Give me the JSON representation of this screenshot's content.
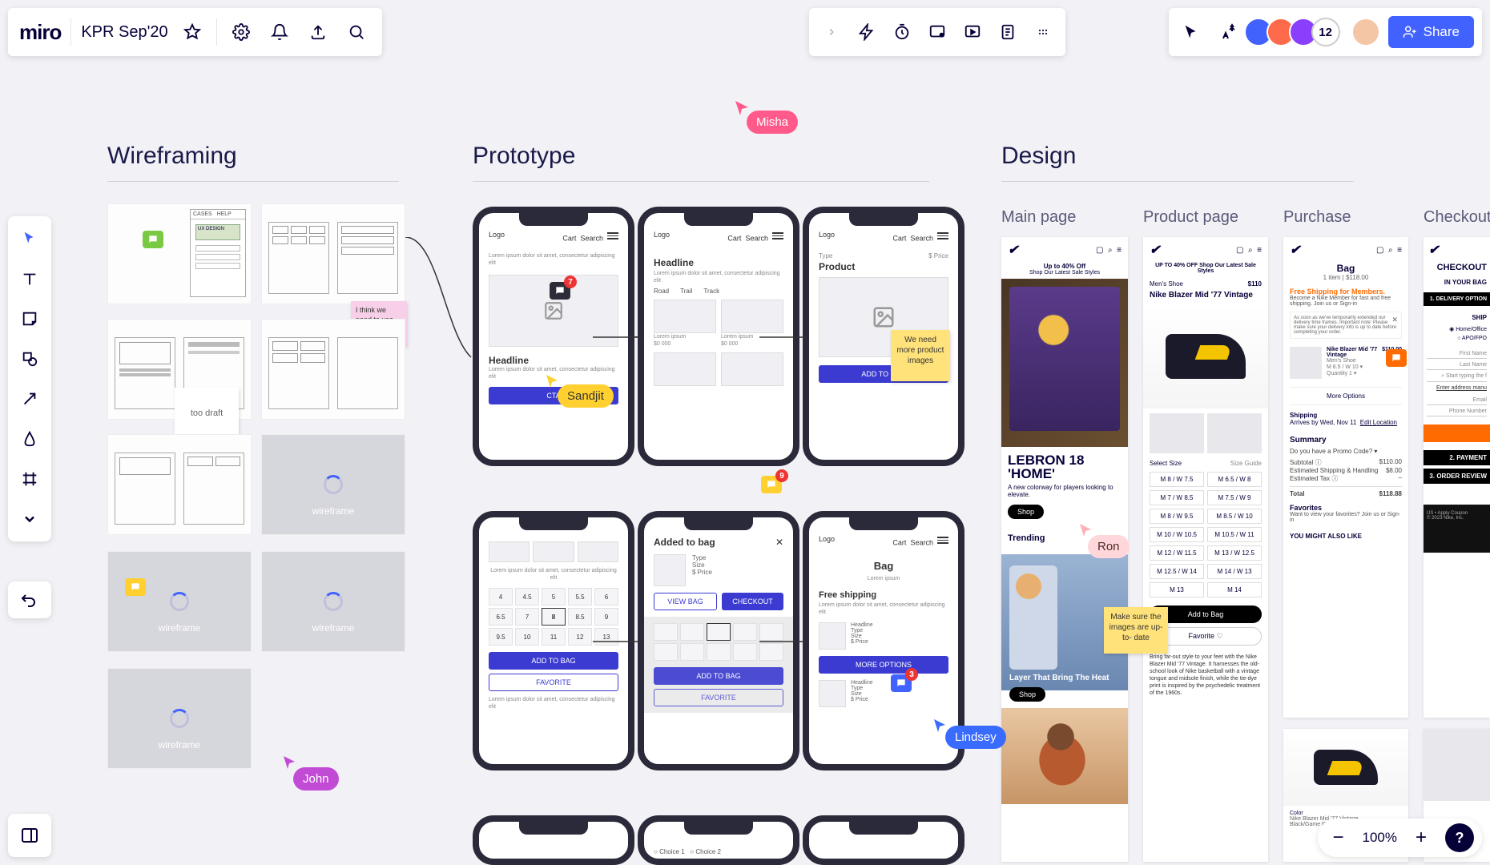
{
  "header": {
    "logo": "miro",
    "board_name": "KPR Sep'20",
    "collaborator_count": "12",
    "share_label": "Share"
  },
  "zoom": {
    "value": "100%"
  },
  "sections": {
    "wireframing": "Wireframing",
    "prototype": "Prototype",
    "design": "Design"
  },
  "design_cols": {
    "main": "Main page",
    "product": "Product page",
    "purchase": "Purchase",
    "checkout": "Checkout"
  },
  "cursors": {
    "misha": "Misha",
    "sandjit": "Sandjit",
    "john": "John",
    "lindsey": "Lindsey",
    "ron": "Ron"
  },
  "stickies": {
    "pink": "I think we need to use one screen",
    "draft": "too draft",
    "product_images": "We need more product images",
    "uptodate": "Make sure the images are up-to- date"
  },
  "wf_placeholder": "wireframe",
  "comment_counts": {
    "c1": "7",
    "c2": "9",
    "c3": "3"
  },
  "proto": {
    "logo": "Logo",
    "cart": "Cart",
    "search": "Search",
    "headline": "Headline",
    "lorem": "Lorem ipsum dolor sit amet, consectetur adipiscing elit",
    "lorem_short": "Lorem ipsum",
    "cta": "CTA",
    "road": "Road",
    "trail": "Trail",
    "track": "Track",
    "view_bag": "VIEW BAG",
    "checkout": "CHECKOUT",
    "add_to_bag": "ADD TO BAG",
    "favorite": "FAVORITE",
    "added_to_bag": "Added to bag",
    "type": "Type",
    "size": "Size",
    "price_label": "$ Price",
    "product": "Product",
    "bag": "Bag",
    "free_ship": "Free shipping",
    "more_options": "MORE OPTIONS",
    "choice1": "Choice 1",
    "choice2": "Choice 2"
  },
  "design": {
    "promo": "Up to 40% Off",
    "promo2": "Shop Our Latest Sale Styles",
    "promo_banner": "UP TO 40% OFF   Shop Our Latest Sale Styles",
    "lebron1": "LEBRON 18",
    "lebron2": "'HOME'",
    "lebron_sub": "A new colorway for players looking to elevate.",
    "shop": "Shop",
    "trending": "Trending",
    "layer_heat": "Layer That Bring The Heat",
    "mens_shoe": "Men's Shoe",
    "blazer": "Nike Blazer Mid '77 Vintage",
    "price": "$110",
    "select_size": "Select Size",
    "size_guide": "Size Guide",
    "sizes": [
      "M 8 / W 7.5",
      "M 6.5 / W 8",
      "M 7 / W 8.5",
      "M 7.5 / W 9",
      "M 8 / W 9.5",
      "M 8.5 / W 10",
      "M 10 / W 10.5",
      "M 10.5 / W 11",
      "M 12 / W 11.5",
      "M 13 / W 12.5",
      "M 12.5 / W 14",
      "M 14 / W 13",
      "M 13",
      "M 14"
    ],
    "add_to_bag_d": "Add to Bag",
    "favorite_d": "Favorite ♡",
    "blurb": "Bring far-out style to your feet with the Nike Blazer Mid '77 Vintage. It harnesses the old-school look of Nike basketball with a vintage tongue and midsole finish, while the tie-dye print is inspired by the psychedelic treatment of the 1960s.",
    "bag_title": "Bag",
    "bag_sub": "1 item | $118.00",
    "free_ship_title": "Free Shipping for Members.",
    "free_ship_body": "Become a Nike Member for fast and free shipping. Join us or Sign-in",
    "size_line": "M 6.5 / W 10  ▾",
    "qty_line": "Quantity  1  ▾",
    "more_opt": "More Options",
    "shipping": "Shipping",
    "arrives": "Arrives by Wed, Nov 11",
    "edit_loc": "Edit Location",
    "summary": "Summary",
    "promo_q": "Do you have a Promo Code?  ▾",
    "subtotal": "Subtotal",
    "subtotal_v": "$110.00",
    "est_ship": "Estimated Shipping & Handling",
    "est_ship_v": "$8.00",
    "est_tax": "Estimated Tax",
    "est_tax_v": "–",
    "total": "Total",
    "total_v": "$118.88",
    "favorites": "Favorites",
    "fav_body": "Want to view your favorites? Join us or Sign-in",
    "also_like": "YOU MIGHT ALSO LIKE",
    "price2": "$110.00",
    "checkout_title": "CHECKOUT",
    "in_bag": "IN YOUR BAG",
    "step1": "1. DELIVERY OPTION",
    "step_ship": "SHIP",
    "home_office": "Home/Office",
    "apo": "APO/FPO",
    "fn": "First Name",
    "ln": "Last Name",
    "addr_hint": "Start typing the f",
    "addr_manual": "Enter address manu",
    "email": "Email",
    "phone": "Phone Number",
    "step2": "2. PAYMENT",
    "step3": "3. ORDER REVIEW",
    "color_label": "Color",
    "color_val": "Black/Game Royal/White/Speed Yellow"
  }
}
